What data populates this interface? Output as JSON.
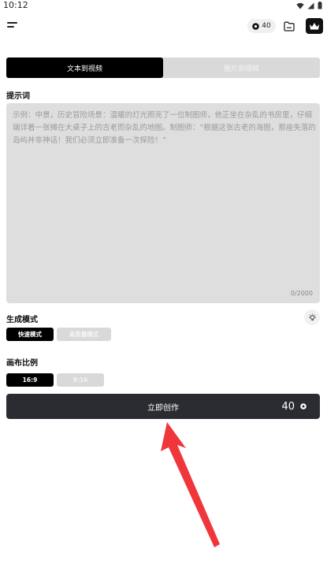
{
  "status_bar": {
    "time": "10:12"
  },
  "header": {
    "credits": "40"
  },
  "tabs": [
    {
      "label": "文本到视频"
    },
    {
      "label": "图片到视频"
    }
  ],
  "prompt": {
    "label": "提示词",
    "placeholder": "示例：中景，历史冒险场景：温暖的灯光照亮了一位制图师，他正坐在杂乱的书房里，仔细端详着一张摊在大桌子上的古老而杂乱的地图。制图师：“根据这张古老的海图，那座失落的岛屿并非神话！我们必须立即准备一次探险！”",
    "counter": "0/2000"
  },
  "mode": {
    "label": "生成模式",
    "options": [
      "快速模式",
      "高质量模式"
    ],
    "selected": "快速模式"
  },
  "ratio": {
    "label": "画布比例",
    "options": [
      "16:9",
      "9:16"
    ],
    "selected": "16:9"
  },
  "create": {
    "label": "立即创作",
    "cost": "40"
  },
  "colors": {
    "accent": "#000000",
    "button": "#2a2c32",
    "arrow": "#f0353b"
  }
}
